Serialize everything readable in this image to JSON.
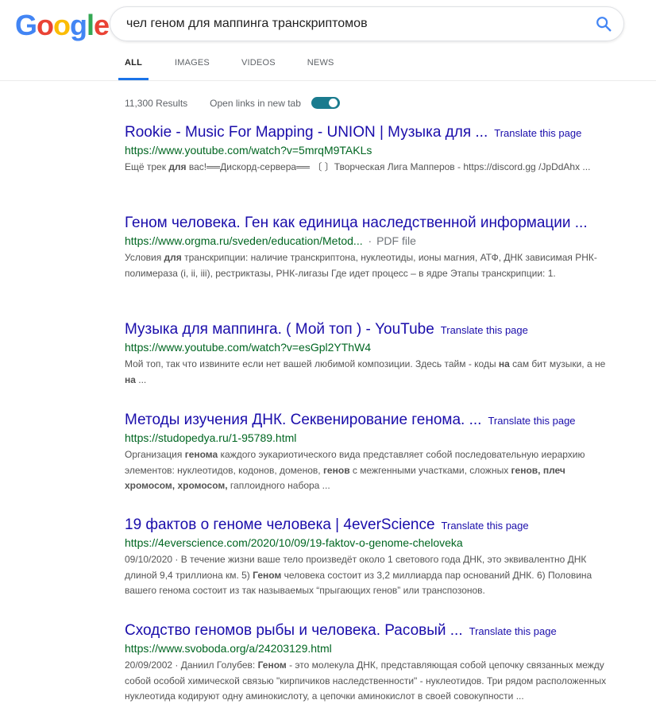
{
  "logo": {
    "letters": [
      "G",
      "o",
      "o",
      "g",
      "l",
      "e"
    ],
    "colors": [
      "#4285F4",
      "#EA4335",
      "#FBBC05",
      "#4285F4",
      "#34A853",
      "#EA4335"
    ]
  },
  "search": {
    "query": "чел геном для маппинга транскриптомов",
    "icon": "search-icon",
    "icon_color": "#4285F4"
  },
  "tabs": [
    {
      "label": "ALL",
      "active": true
    },
    {
      "label": "IMAGES",
      "active": false
    },
    {
      "label": "VIDEOS",
      "active": false
    },
    {
      "label": "NEWS",
      "active": false
    }
  ],
  "stats": {
    "results_count": "11,300 Results",
    "open_new_tab_label": "Open links in new tab",
    "toggle_on": true,
    "toggle_color": "#1a7b8e"
  },
  "results": [
    {
      "title": "Rookie - Music For Mapping - UNION | Музыка для ...",
      "translate": "Translate this page",
      "url": "https://www.youtube.com/watch?v=5mrqM9TAKLs",
      "tag": "",
      "snippet_html": "Ещё трек <b>для</b> вас!══Дискорд-сервера══ 〔 〕Творческая Лига Мапперов - https://discord.gg /JpDdAhx ..."
    },
    {
      "title": "Геном человека. Ген как единица наследственной информации ...",
      "translate": "",
      "url": "https://www.orgma.ru/sveden/education/Metod...",
      "tag": "PDF file",
      "snippet_html": "Условия <b>для</b> транскрипции: наличие транскриптона, нуклеотиды, ионы магния, АТФ, ДНК зависимая РНК-полимераза (i, ii, iii), рестриктазы, РНК-лигазы Где идет процесс – в ядре Этапы транскрипции: 1."
    },
    {
      "title": "Музыка для маппинга. ( Мой топ ) - YouTube",
      "translate": "Translate this page",
      "url": "https://www.youtube.com/watch?v=esGpl2YThW4",
      "tag": "",
      "snippet_html": "Мой топ, так что извините если нет вашей любимой композиции. Здесь тайм - коды <b>на</b> сам бит музыки, а не <b>на</b> ..."
    },
    {
      "title": "Методы изучения ДНК. Секвенирование генома. ...",
      "translate": "Translate this page",
      "url": "https://studopedya.ru/1-95789.html",
      "tag": "",
      "snippet_html": "Организация <b>генома</b> каждого эукариотического вида представляет собой последовательную иерархию элементов: нуклеотидов, кодонов, доменов, <b>генов</b> с межгенными участками, сложных <b>генов, плеч хромосом, хромосом,</b> гаплоидного набора ..."
    },
    {
      "title": "19 фактов о геноме человека | 4everScience",
      "translate": "Translate this page",
      "url": "https://4everscience.com/2020/10/09/19-faktov-o-genome-cheloveka",
      "tag": "",
      "snippet_html": "09/10/2020 · В течение жизни ваше тело произведёт около 1 светового года ДНК, это эквивалентно ДНК длиной 9,4 триллиона км. 5) <b>Геном</b> человека состоит из 3,2 миллиарда пар оснований ДНК. 6) Половина вашего генома состоит из так называемых “прыгающих генов” или транспозонов."
    },
    {
      "title": "Сходство геномов рыбы и человека. Расовый ...",
      "translate": "Translate this page",
      "url": "https://www.svoboda.org/a/24203129.html",
      "tag": "",
      "snippet_html": "20/09/2002 · Даниил Голубев: <b>Геном</b> - это молекула ДНК, представляющая собой цепочку связанных между собой особой химической связью \"кирпичиков наследственности\" - нуклеотидов. Три рядом расположенных нуклеотида кодируют одну аминокислоту, а цепочки аминокислот в своей совокупности ..."
    }
  ]
}
